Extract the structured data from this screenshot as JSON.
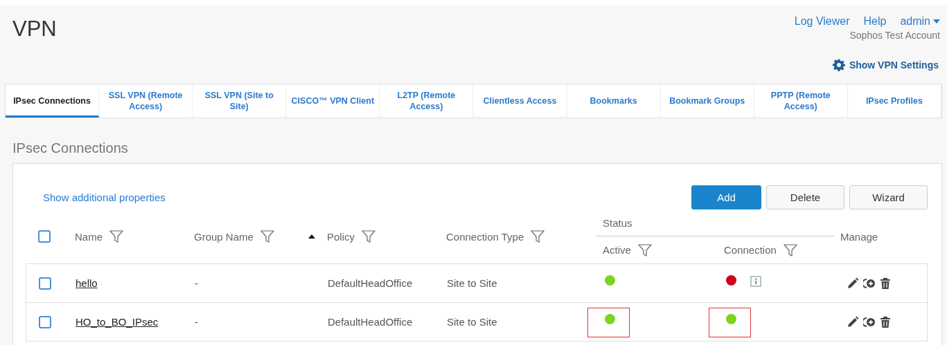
{
  "header": {
    "title": "VPN",
    "links": [
      "Log Viewer",
      "Help"
    ],
    "user": "admin",
    "account": "Sophos Test Account",
    "settings_link": "Show VPN Settings"
  },
  "tabs": [
    {
      "label": "IPsec Connections",
      "selected": true
    },
    {
      "label": "SSL VPN (Remote Access)",
      "selected": false
    },
    {
      "label": "SSL VPN (Site to Site)",
      "selected": false
    },
    {
      "label": "CISCO™ VPN Client",
      "selected": false
    },
    {
      "label": "L2TP (Remote Access)",
      "selected": false
    },
    {
      "label": "Clientless Access",
      "selected": false
    },
    {
      "label": "Bookmarks",
      "selected": false
    },
    {
      "label": "Bookmark Groups",
      "selected": false
    },
    {
      "label": "PPTP (Remote Access)",
      "selected": false
    },
    {
      "label": "IPsec Profiles",
      "selected": false
    }
  ],
  "section_title": "IPsec Connections",
  "panel": {
    "properties_link": "Show additional properties",
    "buttons": [
      {
        "label": "Add",
        "kind": "primary"
      },
      {
        "label": "Delete",
        "kind": "default"
      },
      {
        "label": "Wizard",
        "kind": "default"
      }
    ],
    "table": {
      "select_all": {
        "checked": false
      },
      "columns": {
        "name": "Name",
        "group": "Group Name",
        "policy": "Policy",
        "type": "Connection Type",
        "status": "Status",
        "active": "Active",
        "connection": "Connection",
        "manage": "Manage"
      },
      "rows": [
        {
          "checked": false,
          "name": "hello",
          "group": "-",
          "policy": "DefaultHeadOffice",
          "type": "Site to Site",
          "active": {
            "color": "#7ed321",
            "highlighted": false
          },
          "connection": {
            "color": "#d0021b",
            "highlighted": false,
            "info": true
          }
        },
        {
          "checked": false,
          "name": "HO_to_BO_IPsec",
          "group": "-",
          "policy": "DefaultHeadOffice",
          "type": "Site to Site",
          "active": {
            "color": "#7ed321",
            "highlighted": true
          },
          "connection": {
            "color": "#7ed321",
            "highlighted": true,
            "info": false
          }
        }
      ]
    }
  }
}
